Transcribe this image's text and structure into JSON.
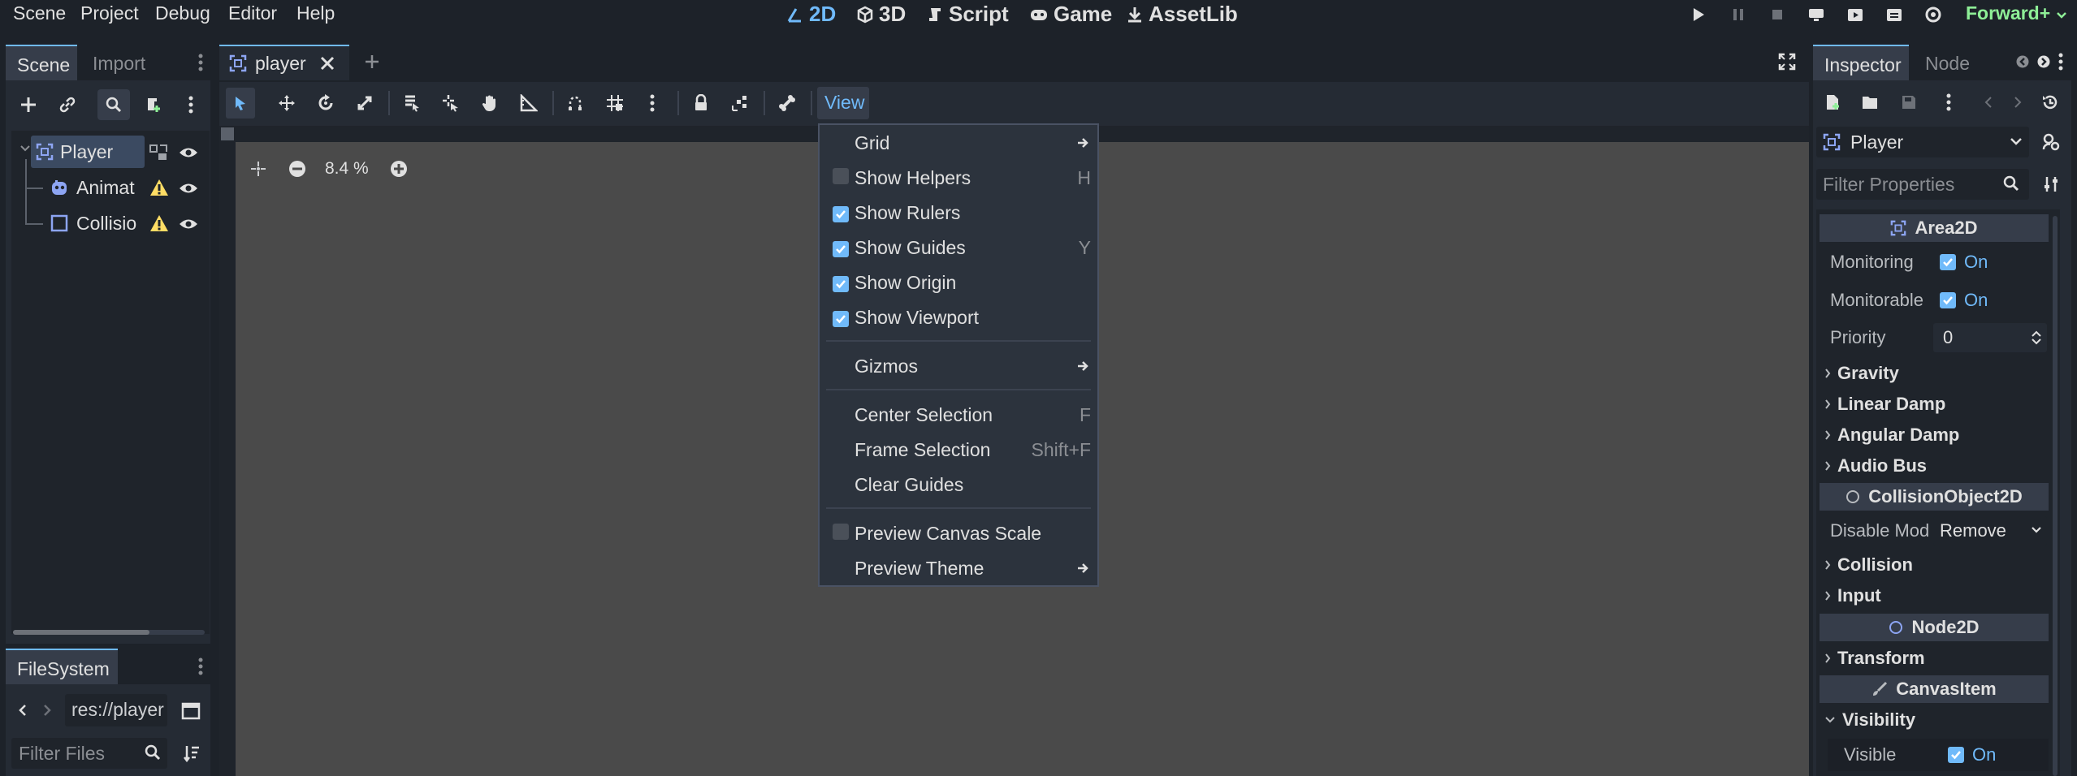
{
  "menubar": {
    "items": [
      "Scene",
      "Project",
      "Debug",
      "Editor",
      "Help"
    ],
    "workspaces": [
      "2D",
      "3D",
      "Script",
      "Game",
      "AssetLib"
    ],
    "renderer": "Forward+"
  },
  "scene_dock": {
    "tabs": [
      "Scene",
      "Import"
    ],
    "nodes": [
      {
        "name": "Player"
      },
      {
        "name": "Animat"
      },
      {
        "name": "Collisio"
      }
    ]
  },
  "filesystem": {
    "tab": "FileSystem",
    "path": "res://player",
    "filter_placeholder": "Filter Files"
  },
  "editor": {
    "scene_tab": "player",
    "view_button": "View",
    "zoom": "8.4 %"
  },
  "view_menu": {
    "items": [
      {
        "label": "Grid",
        "submenu": true
      },
      {
        "label": "Show Helpers",
        "checked": false,
        "shortcut": "H"
      },
      {
        "label": "Show Rulers",
        "checked": true,
        "shortcut": ""
      },
      {
        "label": "Show Guides",
        "checked": true,
        "shortcut": "Y"
      },
      {
        "label": "Show Origin",
        "checked": true,
        "shortcut": ""
      },
      {
        "label": "Show Viewport",
        "checked": true,
        "shortcut": ""
      },
      {
        "label": "Gizmos",
        "submenu": true
      },
      {
        "label": "Center Selection",
        "shortcut": "F"
      },
      {
        "label": "Frame Selection",
        "shortcut": "Shift+F"
      },
      {
        "label": "Clear Guides",
        "shortcut": ""
      },
      {
        "label": "Preview Canvas Scale",
        "checked": false
      },
      {
        "label": "Preview Theme",
        "submenu": true
      }
    ]
  },
  "inspector": {
    "tabs": [
      "Inspector",
      "Node"
    ],
    "object_name": "Player",
    "filter_placeholder": "Filter Properties",
    "sections": {
      "area2d": "Area2D",
      "collision_object": "CollisionObject2D",
      "node2d": "Node2D",
      "canvas_item": "CanvasItem"
    },
    "props": {
      "monitoring": {
        "label": "Monitoring",
        "value": "On"
      },
      "monitorable": {
        "label": "Monitorable",
        "value": "On"
      },
      "priority": {
        "label": "Priority",
        "value": "0"
      },
      "disable_mode": {
        "label": "Disable Mod",
        "value": "Remove"
      },
      "visible": {
        "label": "Visible",
        "value": "On"
      }
    },
    "categories": {
      "gravity": "Gravity",
      "linear_damp": "Linear Damp",
      "angular_damp": "Angular Damp",
      "audio_bus": "Audio Bus",
      "collision": "Collision",
      "input": "Input",
      "transform": "Transform",
      "visibility": "Visibility"
    }
  },
  "colors": {
    "accent": "#70bafa",
    "warning": "#ffdd65",
    "renderer": "#8eef97"
  }
}
